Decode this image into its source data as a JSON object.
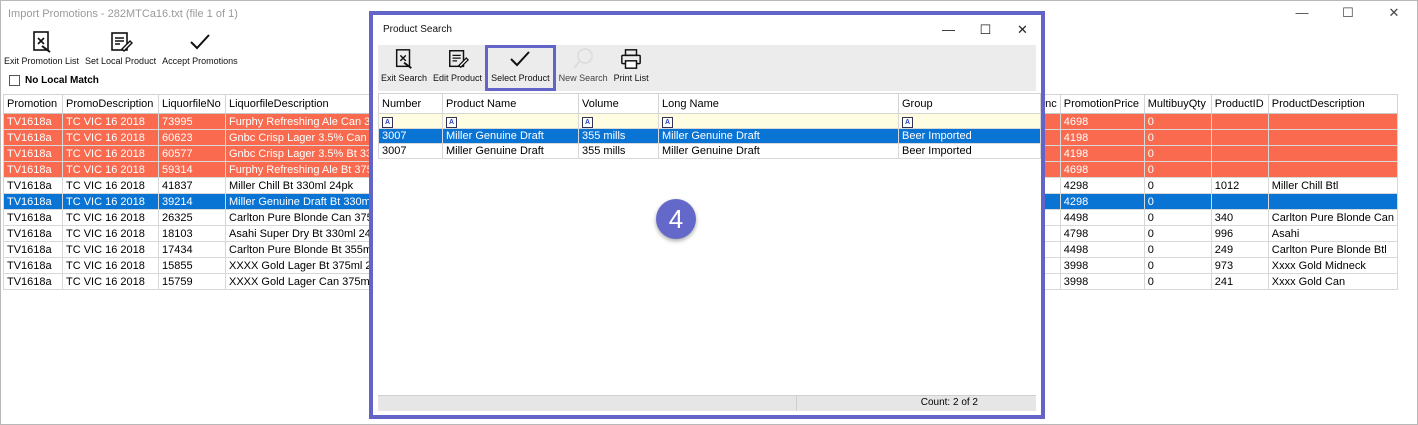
{
  "window": {
    "title": "Import Promotions - 282MTCa16.txt (file 1 of 1)",
    "controls": {
      "minimize": "—",
      "maximize": "☐",
      "close": "✕"
    }
  },
  "toolbar": {
    "exit_label": "Exit Promotion List",
    "set_local_label": "Set Local Product",
    "accept_label": "Accept Promotions"
  },
  "no_local_match": {
    "label": "No Local Match",
    "checked": false
  },
  "grid": {
    "columns": [
      "Promotion",
      "PromoDescription",
      "LiquorfileNo",
      "LiquorfileDescription",
      "stInc",
      "PromotionPrice",
      "MultibuyQty",
      "ProductID",
      "ProductDescription"
    ],
    "rows": [
      {
        "style": "red",
        "promotion": "TV1618a",
        "desc": "TC VIC 16 2018",
        "no": "73995",
        "ldesc": "Furphy Refreshing Ale Can 3",
        "price": "4698",
        "multi": "0",
        "pid": "",
        "pdesc": ""
      },
      {
        "style": "red",
        "promotion": "TV1618a",
        "desc": "TC VIC 16 2018",
        "no": "60623",
        "ldesc": "Gnbc Crisp Lager 3.5% Can 3",
        "price": "4198",
        "multi": "0",
        "pid": "",
        "pdesc": ""
      },
      {
        "style": "red",
        "promotion": "TV1618a",
        "desc": "TC VIC 16 2018",
        "no": "60577",
        "ldesc": "Gnbc Crisp Lager 3.5% Bt 33",
        "price": "4198",
        "multi": "0",
        "pid": "",
        "pdesc": ""
      },
      {
        "style": "red",
        "promotion": "TV1618a",
        "desc": "TC VIC 16 2018",
        "no": "59314",
        "ldesc": "Furphy Refreshing Ale Bt 375",
        "price": "4698",
        "multi": "0",
        "pid": "",
        "pdesc": ""
      },
      {
        "style": "",
        "promotion": "TV1618a",
        "desc": "TC VIC 16 2018",
        "no": "41837",
        "ldesc": "Miller Chill Bt 330ml 24pk",
        "price": "4298",
        "multi": "0",
        "pid": "1012",
        "pdesc": "Miller Chill Btl"
      },
      {
        "style": "blue",
        "promotion": "TV1618a",
        "desc": "TC VIC 16 2018",
        "no": "39214",
        "ldesc": "Miller Genuine Draft Bt 330m",
        "price": "4298",
        "multi": "0",
        "pid": "",
        "pdesc": ""
      },
      {
        "style": "",
        "promotion": "TV1618a",
        "desc": "TC VIC 16 2018",
        "no": "26325",
        "ldesc": "Carlton Pure Blonde Can 375",
        "price": "4498",
        "multi": "0",
        "pid": "340",
        "pdesc": "Carlton Pure Blonde Can"
      },
      {
        "style": "",
        "promotion": "TV1618a",
        "desc": "TC VIC 16 2018",
        "no": "18103",
        "ldesc": "Asahi Super Dry Bt 330ml 24",
        "price": "4798",
        "multi": "0",
        "pid": "996",
        "pdesc": "Asahi"
      },
      {
        "style": "",
        "promotion": "TV1618a",
        "desc": "TC VIC 16 2018",
        "no": "17434",
        "ldesc": "Carlton Pure Blonde Bt 355m",
        "price": "4498",
        "multi": "0",
        "pid": "249",
        "pdesc": "Carlton Pure Blonde Btl"
      },
      {
        "style": "",
        "promotion": "TV1618a",
        "desc": "TC VIC 16 2018",
        "no": "15855",
        "ldesc": "XXXX Gold Lager Bt 375ml 2",
        "price": "3998",
        "multi": "0",
        "pid": "973",
        "pdesc": "Xxxx Gold Midneck"
      },
      {
        "style": "",
        "promotion": "TV1618a",
        "desc": "TC VIC 16 2018",
        "no": "15759",
        "ldesc": "XXXX Gold Lager Can 375ml",
        "price": "3998",
        "multi": "0",
        "pid": "241",
        "pdesc": "Xxxx Gold Can"
      }
    ]
  },
  "dialog": {
    "title": "Product Search",
    "controls": {
      "minimize": "—",
      "maximize": "☐",
      "close": "✕"
    },
    "toolbar": {
      "exit_label": "Exit Search",
      "edit_label": "Edit Product",
      "select_label": "Select Product",
      "new_search_label": "New Search",
      "print_label": "Print List"
    },
    "columns": [
      "Number",
      "Product Name",
      "Volume",
      "Long Name",
      "Group"
    ],
    "filter_glyph": "A",
    "rows": [
      {
        "selected": true,
        "number": "3007",
        "name": "Miller Genuine Draft",
        "volume": "355 mills",
        "long_name": "Miller Genuine Draft",
        "group": "Beer Imported"
      },
      {
        "selected": false,
        "number": "3007",
        "name": "Miller Genuine Draft",
        "volume": "355 mills",
        "long_name": "Miller Genuine Draft",
        "group": "Beer Imported"
      }
    ],
    "footer": {
      "count": "Count: 2 of 2"
    }
  },
  "step_badge": "4",
  "colors": {
    "accent": "#6265c7",
    "selected_row": "#0a74d4",
    "error_row": "#f96a4f",
    "filter_row": "#fffde1"
  }
}
